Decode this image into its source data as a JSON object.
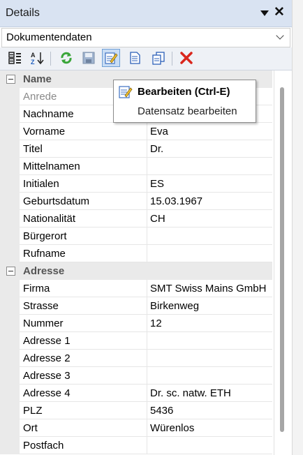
{
  "panel": {
    "title": "Details"
  },
  "selector": {
    "value": "Dokumentendaten"
  },
  "toolbar": {
    "buttons": [
      {
        "icon": "categorized-icon",
        "tooltip": ""
      },
      {
        "icon": "sort-alphabetical-icon",
        "tooltip": ""
      },
      {
        "icon": "refresh-icon",
        "tooltip": ""
      },
      {
        "icon": "save-icon",
        "tooltip": ""
      },
      {
        "icon": "edit-icon",
        "tooltip": "Bearbeiten (Ctrl-E)"
      },
      {
        "icon": "new-document-icon",
        "tooltip": ""
      },
      {
        "icon": "copy-document-icon",
        "tooltip": ""
      },
      {
        "icon": "delete-icon",
        "tooltip": ""
      }
    ]
  },
  "tooltip": {
    "title": "Bearbeiten (Ctrl-E)",
    "description": "Datensatz bearbeiten"
  },
  "grid": {
    "categories": [
      {
        "name": "Name",
        "rows": [
          {
            "label": "Anrede",
            "value": ""
          },
          {
            "label": "Nachname",
            "value": ""
          },
          {
            "label": "Vorname",
            "value": "Eva"
          },
          {
            "label": "Titel",
            "value": "Dr."
          },
          {
            "label": "Mittelnamen",
            "value": ""
          },
          {
            "label": "Initialen",
            "value": "ES"
          },
          {
            "label": "Geburtsdatum",
            "value": "15.03.1967"
          },
          {
            "label": "Nationalität",
            "value": "CH"
          },
          {
            "label": "Bürgerort",
            "value": ""
          },
          {
            "label": "Rufname",
            "value": ""
          }
        ]
      },
      {
        "name": "Adresse",
        "rows": [
          {
            "label": "Firma",
            "value": "SMT Swiss Mains GmbH"
          },
          {
            "label": "Strasse",
            "value": "Birkenweg"
          },
          {
            "label": "Nummer",
            "value": "12"
          },
          {
            "label": "Adresse 1",
            "value": ""
          },
          {
            "label": "Adresse 2",
            "value": ""
          },
          {
            "label": "Adresse 3",
            "value": ""
          },
          {
            "label": "Adresse 4",
            "value": "Dr. sc. natw. ETH"
          },
          {
            "label": "PLZ",
            "value": "5436"
          },
          {
            "label": "Ort",
            "value": "Würenlos"
          },
          {
            "label": "Postfach",
            "value": ""
          }
        ]
      }
    ]
  }
}
